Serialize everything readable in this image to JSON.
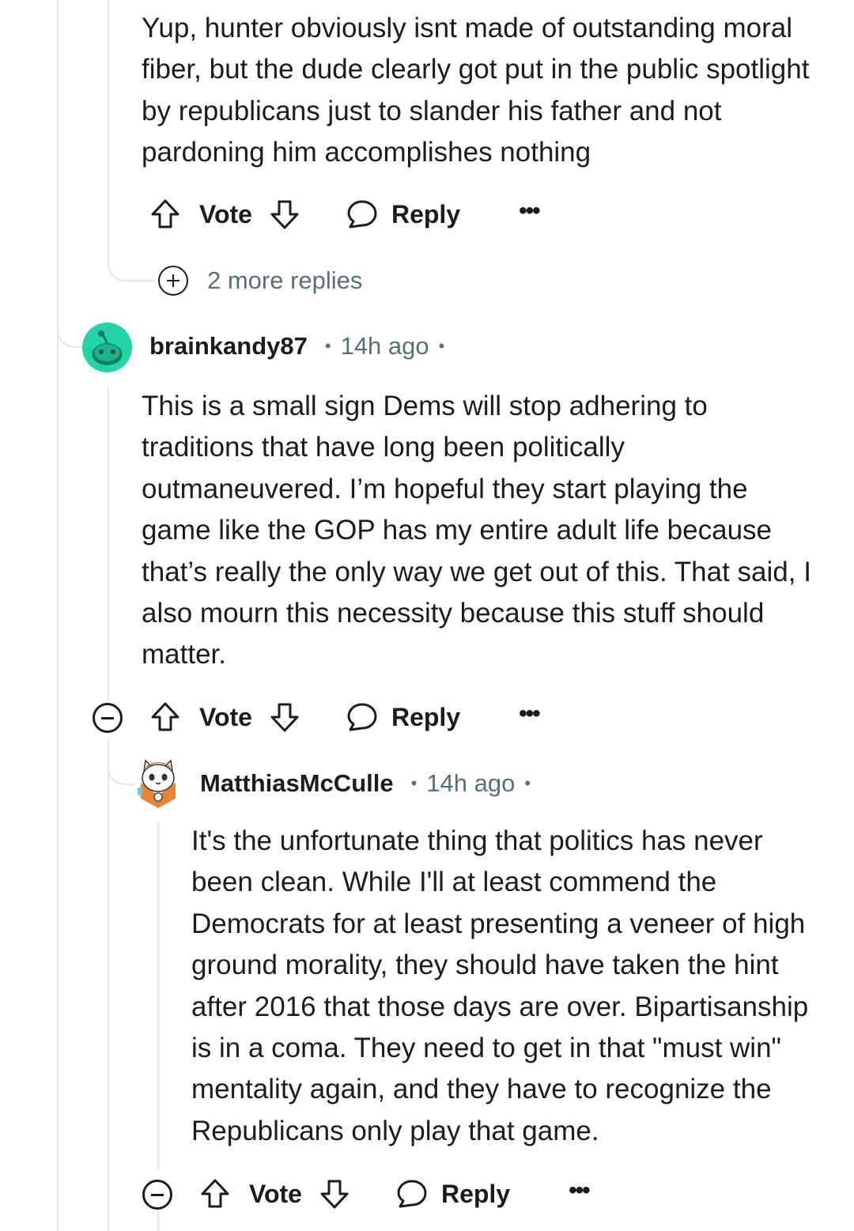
{
  "comments": [
    {
      "body": "Yup, hunter obviously isnt made of outstanding moral fiber, but the dude clearly got put in the public spotlight by republicans just to slander his father and not pardoning him accomplishes nothing",
      "actions": {
        "vote": "Vote",
        "reply": "Reply",
        "more": "•••"
      },
      "more_replies": "2 more replies"
    },
    {
      "username": "brainkandy87",
      "time": "14h ago",
      "separator": "•",
      "avatar_color": "#24d3a7",
      "body": "This is a small sign Dems will stop adhering to traditions that have long been politically outmaneuvered. I’m hopeful they start playing the game like the GOP has my entire adult life because that’s really the only way we get out of this. That said, I also mourn this necessity because this stuff should matter.",
      "actions": {
        "vote": "Vote",
        "reply": "Reply",
        "more": "•••"
      }
    },
    {
      "username": "MatthiasMcCulle",
      "time": "14h ago",
      "separator": "•",
      "body": "It's the unfortunate thing that politics has never been clean. While I'll at least commend the Democrats for at least presenting a veneer of high ground morality, they should have taken the hint after 2016 that those days are over. Bipartisanship is in a coma. They need to get in that \"must win\" mentality again, and they have to recognize the Republicans only play that game.",
      "actions": {
        "vote": "Vote",
        "reply": "Reply",
        "more": "•••"
      }
    }
  ],
  "colors": {
    "text": "#1c1c1c",
    "meta": "#576f76",
    "thread_line": "#e3e5e8"
  }
}
